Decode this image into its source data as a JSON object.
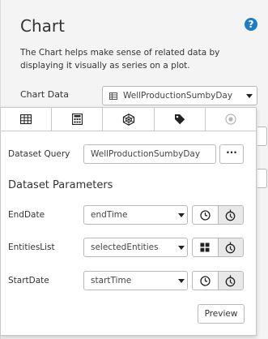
{
  "header": {
    "title": "Chart",
    "description": "The Chart helps make sense of related data by displaying it visually as series on a plot."
  },
  "chart_data_field": {
    "label": "Chart Data",
    "value": "WellProductionSumbyDay"
  },
  "tabs": [
    {
      "icon": "table-icon"
    },
    {
      "icon": "calculator-icon"
    },
    {
      "icon": "series-icon"
    },
    {
      "icon": "tag-icon"
    },
    {
      "icon": "target-icon"
    }
  ],
  "dataset_query": {
    "label": "Dataset Query",
    "value": "WellProductionSumbyDay",
    "more_label": "···"
  },
  "parameters": {
    "title": "Dataset Parameters",
    "items": [
      {
        "label": "EndDate",
        "value": "endTime",
        "mode_icon": "clock-icon"
      },
      {
        "label": "EntitiesList",
        "value": "selectedEntities",
        "mode_icon": "grid-icon"
      },
      {
        "label": "StartDate",
        "value": "startTime",
        "mode_icon": "clock-icon"
      }
    ]
  },
  "preview_label": "Preview",
  "colors": {
    "accent": "#1f7dc4",
    "border": "#b9b9b9",
    "panel_bg": "#f4f4f4"
  }
}
